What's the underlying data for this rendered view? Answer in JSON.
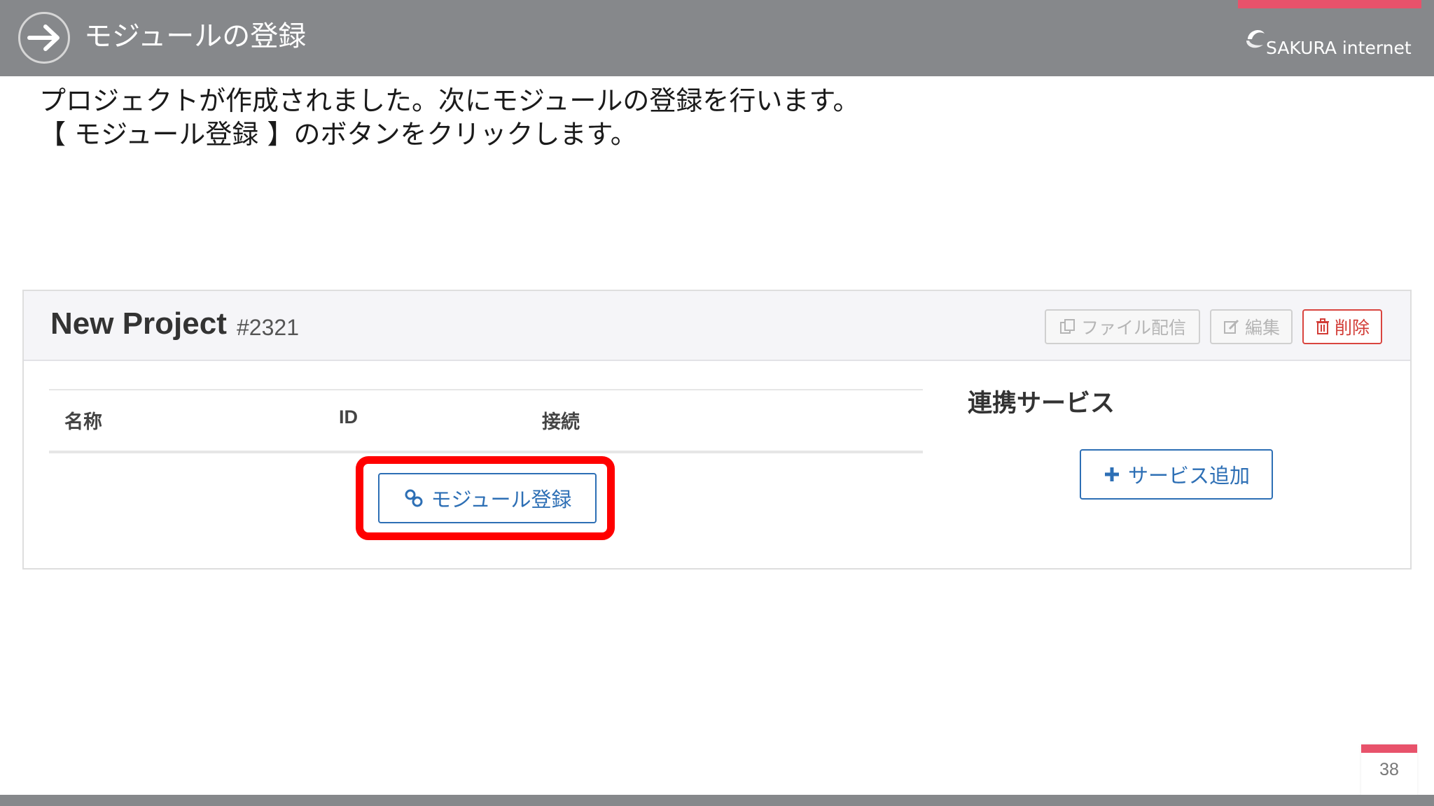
{
  "slide": {
    "title": "モジュールの登録",
    "logo_text": "SAKURA internet",
    "page_number": "38",
    "accent_color": "#e8526b",
    "header_color": "#86888b"
  },
  "instructions": {
    "line1": "プロジェクトが作成されました。次にモジュールの登録を行います。",
    "line2": "【 モジュール登録 】のボタンをクリックします。"
  },
  "project": {
    "name": "New Project",
    "id": "#2321",
    "toolbar": {
      "file_delivery_label": "ファイル配信",
      "edit_label": "編集",
      "delete_label": "削除"
    },
    "modules_table": {
      "columns": [
        "名称",
        "ID",
        "接続"
      ],
      "register_button_label": "モジュール登録"
    },
    "services": {
      "title": "連携サービス",
      "add_button_label": "サービス追加"
    },
    "highlight_color": "#ff0000",
    "link_color": "#2d6fb5"
  }
}
